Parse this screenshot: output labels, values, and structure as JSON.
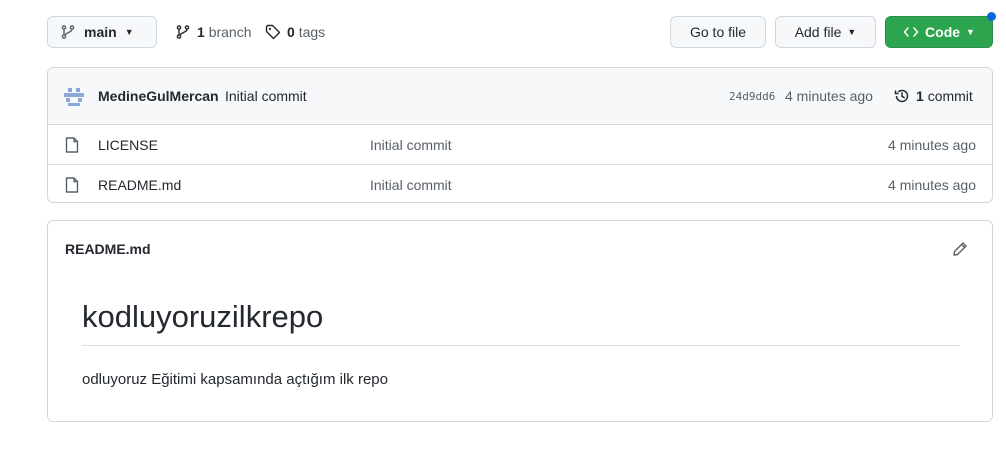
{
  "topbar": {
    "branch_label": "main",
    "branches_count": "1",
    "branches_label": "branch",
    "tags_count": "0",
    "tags_label": "tags",
    "goto_label": "Go to file",
    "addfile_label": "Add file",
    "code_label": "Code"
  },
  "commit": {
    "author": "MedineGulMercan",
    "message": "Initial commit",
    "sha": "24d9dd6",
    "time": "4 minutes ago",
    "count": "1",
    "count_label": "commit"
  },
  "files": [
    {
      "name": "LICENSE",
      "commit": "Initial commit",
      "age": "4 minutes ago"
    },
    {
      "name": "README.md",
      "commit": "Initial commit",
      "age": "4 minutes ago"
    }
  ],
  "readme": {
    "title": "README.md",
    "heading": "kodluyoruzilkrepo",
    "body": "odluyoruz Eğitimi kapsamında açtığım ilk repo"
  },
  "colors": {
    "code_button": "#2da44e",
    "notification_dot": "#0969da"
  },
  "icons": {
    "branch": "git-branch-icon",
    "tag": "tag-icon",
    "history": "history-icon",
    "file": "file-icon",
    "pencil": "pencil-icon",
    "code": "code-icon",
    "avatar": "avatar-identicon"
  }
}
